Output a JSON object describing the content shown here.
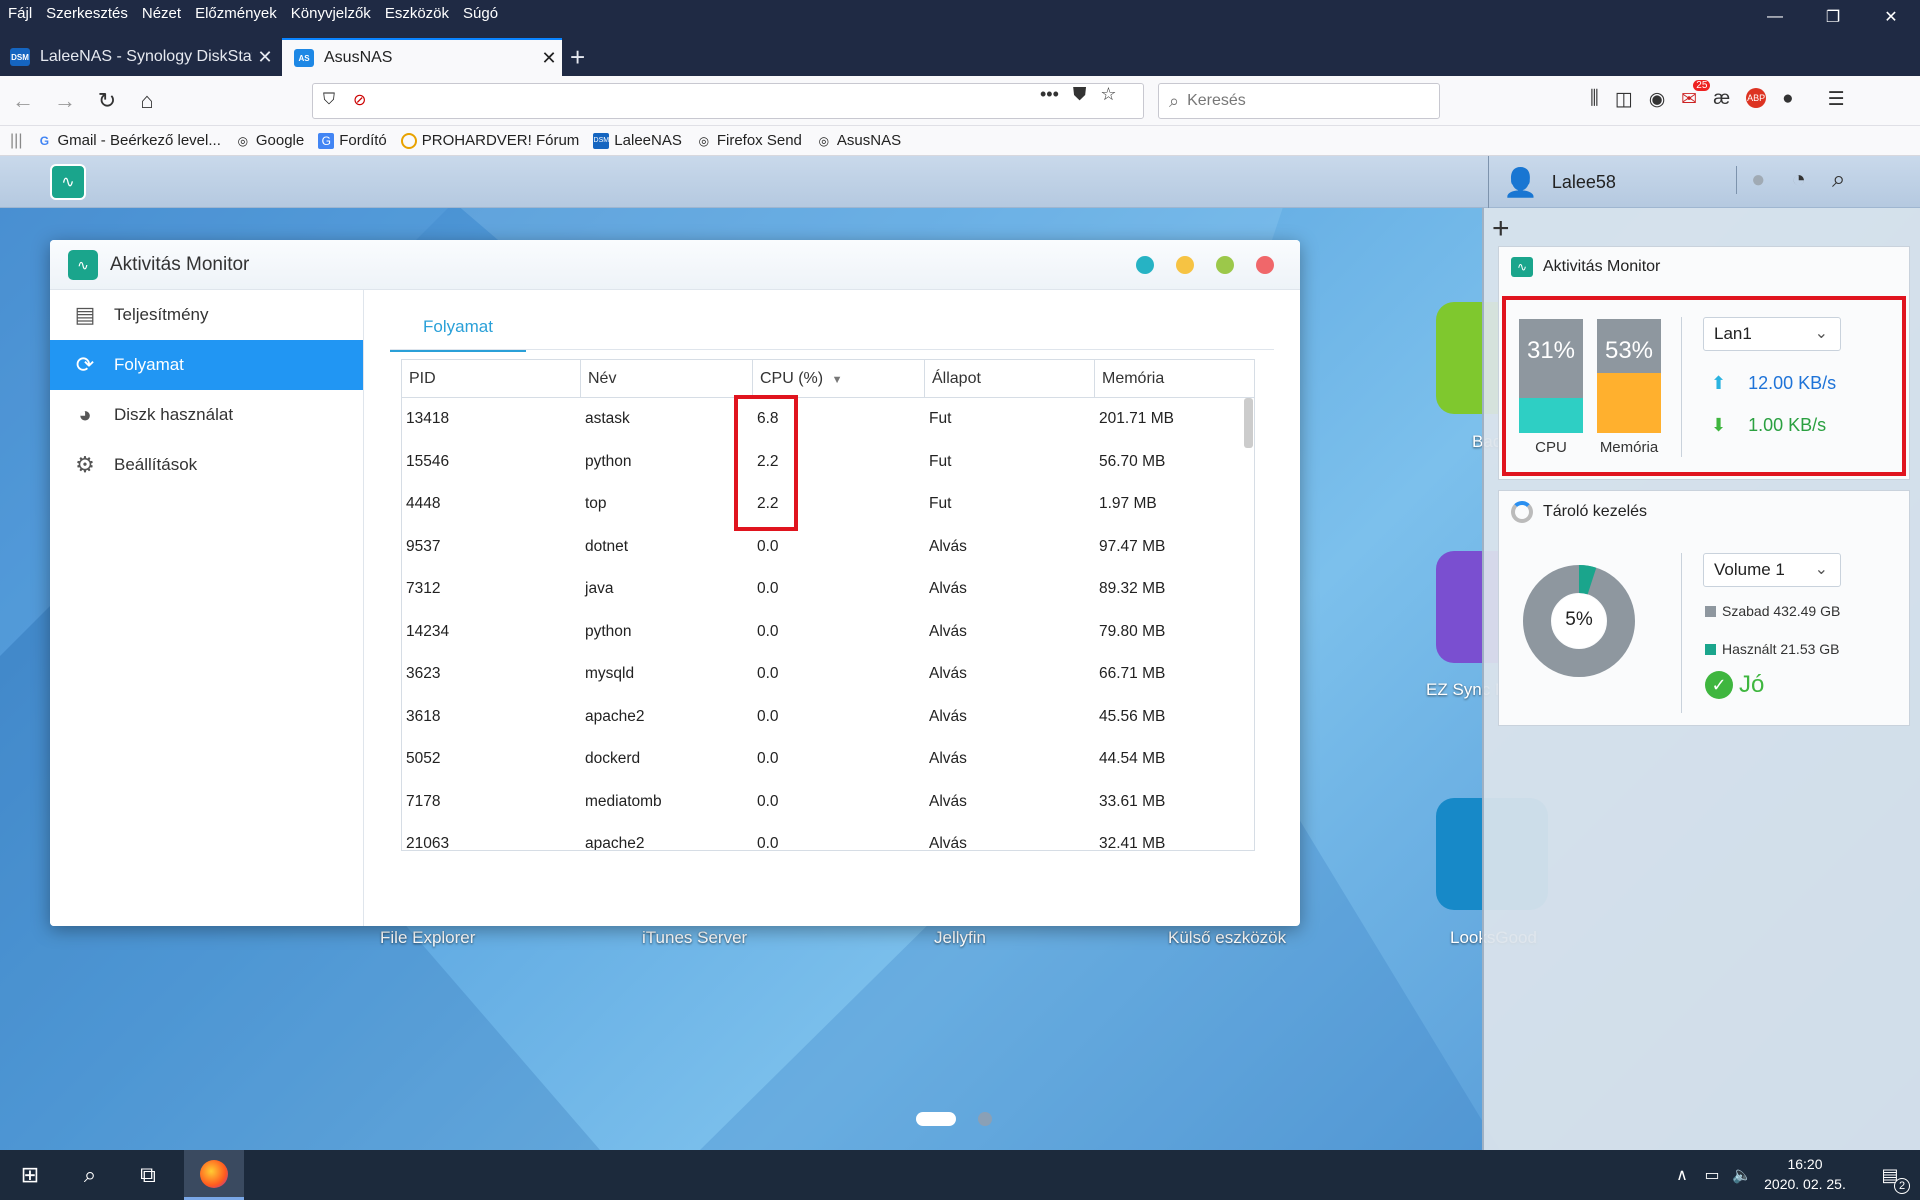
{
  "menu": [
    "Fájl",
    "Szerkesztés",
    "Nézet",
    "Előzmények",
    "Könyvjelzők",
    "Eszközök",
    "Súgó"
  ],
  "tabs": [
    {
      "label": "LaleeNAS - Synology DiskStation",
      "favicon": "DSM",
      "active": false
    },
    {
      "label": "AsusNAS",
      "favicon": "AS",
      "active": true
    }
  ],
  "search": {
    "placeholder": "Keresés"
  },
  "toolbar": {
    "mail_badge": "25",
    "ae": "æ",
    "abp": "ABP"
  },
  "bookmarks": [
    {
      "label": "Gmail - Beérkező level...",
      "icon": "G"
    },
    {
      "label": "Google",
      "icon": "globe"
    },
    {
      "label": "Fordító",
      "icon": "G"
    },
    {
      "label": "PROHARDVER! Fórum",
      "icon": "ph"
    },
    {
      "label": "LaleeNAS",
      "icon": "DSM"
    },
    {
      "label": "Firefox Send",
      "icon": "globe"
    },
    {
      "label": "AsusNAS",
      "icon": "globe"
    }
  ],
  "dsm": {
    "user": "Lalee58"
  },
  "desktop_labels": [
    {
      "label": "File Explorer"
    },
    {
      "label": "iTunes Server"
    },
    {
      "label": "Jellyfin"
    },
    {
      "label": "Külső eszközök"
    },
    {
      "label": "Back Helyr"
    },
    {
      "label": "EZ Sync Man"
    },
    {
      "label": "LooksGood"
    }
  ],
  "window": {
    "title": "Aktivitás Monitor",
    "sidebar": [
      {
        "label": "Teljesítmény",
        "icon": "chart-icon"
      },
      {
        "label": "Folyamat",
        "icon": "sync-icon",
        "selected": true
      },
      {
        "label": "Diszk használat",
        "icon": "disk-icon"
      },
      {
        "label": "Beállítások",
        "icon": "gear-icon"
      }
    ],
    "tab": "Folyamat",
    "columns": [
      "PID",
      "Név",
      "CPU (%)",
      "Állapot",
      "Memória"
    ],
    "rows": [
      [
        "13418",
        "astask",
        "6.8",
        "Fut",
        "201.71 MB"
      ],
      [
        "15546",
        "python",
        "2.2",
        "Fut",
        "56.70 MB"
      ],
      [
        "4448",
        "top",
        "2.2",
        "Fut",
        "1.97 MB"
      ],
      [
        "9537",
        "dotnet",
        "0.0",
        "Alvás",
        "97.47 MB"
      ],
      [
        "7312",
        "java",
        "0.0",
        "Alvás",
        "89.32 MB"
      ],
      [
        "14234",
        "python",
        "0.0",
        "Alvás",
        "79.80 MB"
      ],
      [
        "3623",
        "mysqld",
        "0.0",
        "Alvás",
        "66.71 MB"
      ],
      [
        "3618",
        "apache2",
        "0.0",
        "Alvás",
        "45.56 MB"
      ],
      [
        "5052",
        "dockerd",
        "0.0",
        "Alvás",
        "44.54 MB"
      ],
      [
        "7178",
        "mediatomb",
        "0.0",
        "Alvás",
        "33.61 MB"
      ],
      [
        "21063",
        "apache2",
        "0.0",
        "Alvás",
        "32.41 MB"
      ]
    ]
  },
  "widget_monitor": {
    "title": "Aktivitás Monitor",
    "cpu": {
      "label": "CPU",
      "pct_text": "31%",
      "value": 31,
      "color": "#2ecfc4"
    },
    "mem": {
      "label": "Memória",
      "pct_text": "53%",
      "value": 53,
      "color": "#ffb02e"
    },
    "interface": "Lan1",
    "upload": "12.00 KB/s",
    "download": "1.00 KB/s"
  },
  "widget_storage": {
    "title": "Tároló kezelés",
    "volume": "Volume 1",
    "used_pct_text": "5%",
    "used_pct": 5,
    "free": "Szabad 432.49 GB",
    "used": "Használt 21.53 GB",
    "status": "Jó"
  },
  "taskbar": {
    "time": "16:20",
    "date": "2020. 02. 25.",
    "notif": "2"
  },
  "colors": {
    "accent": "#2196f3",
    "tab_accent": "#2aa0d8",
    "highlight": "#e0141e",
    "status_ok": "#3fb63f"
  }
}
